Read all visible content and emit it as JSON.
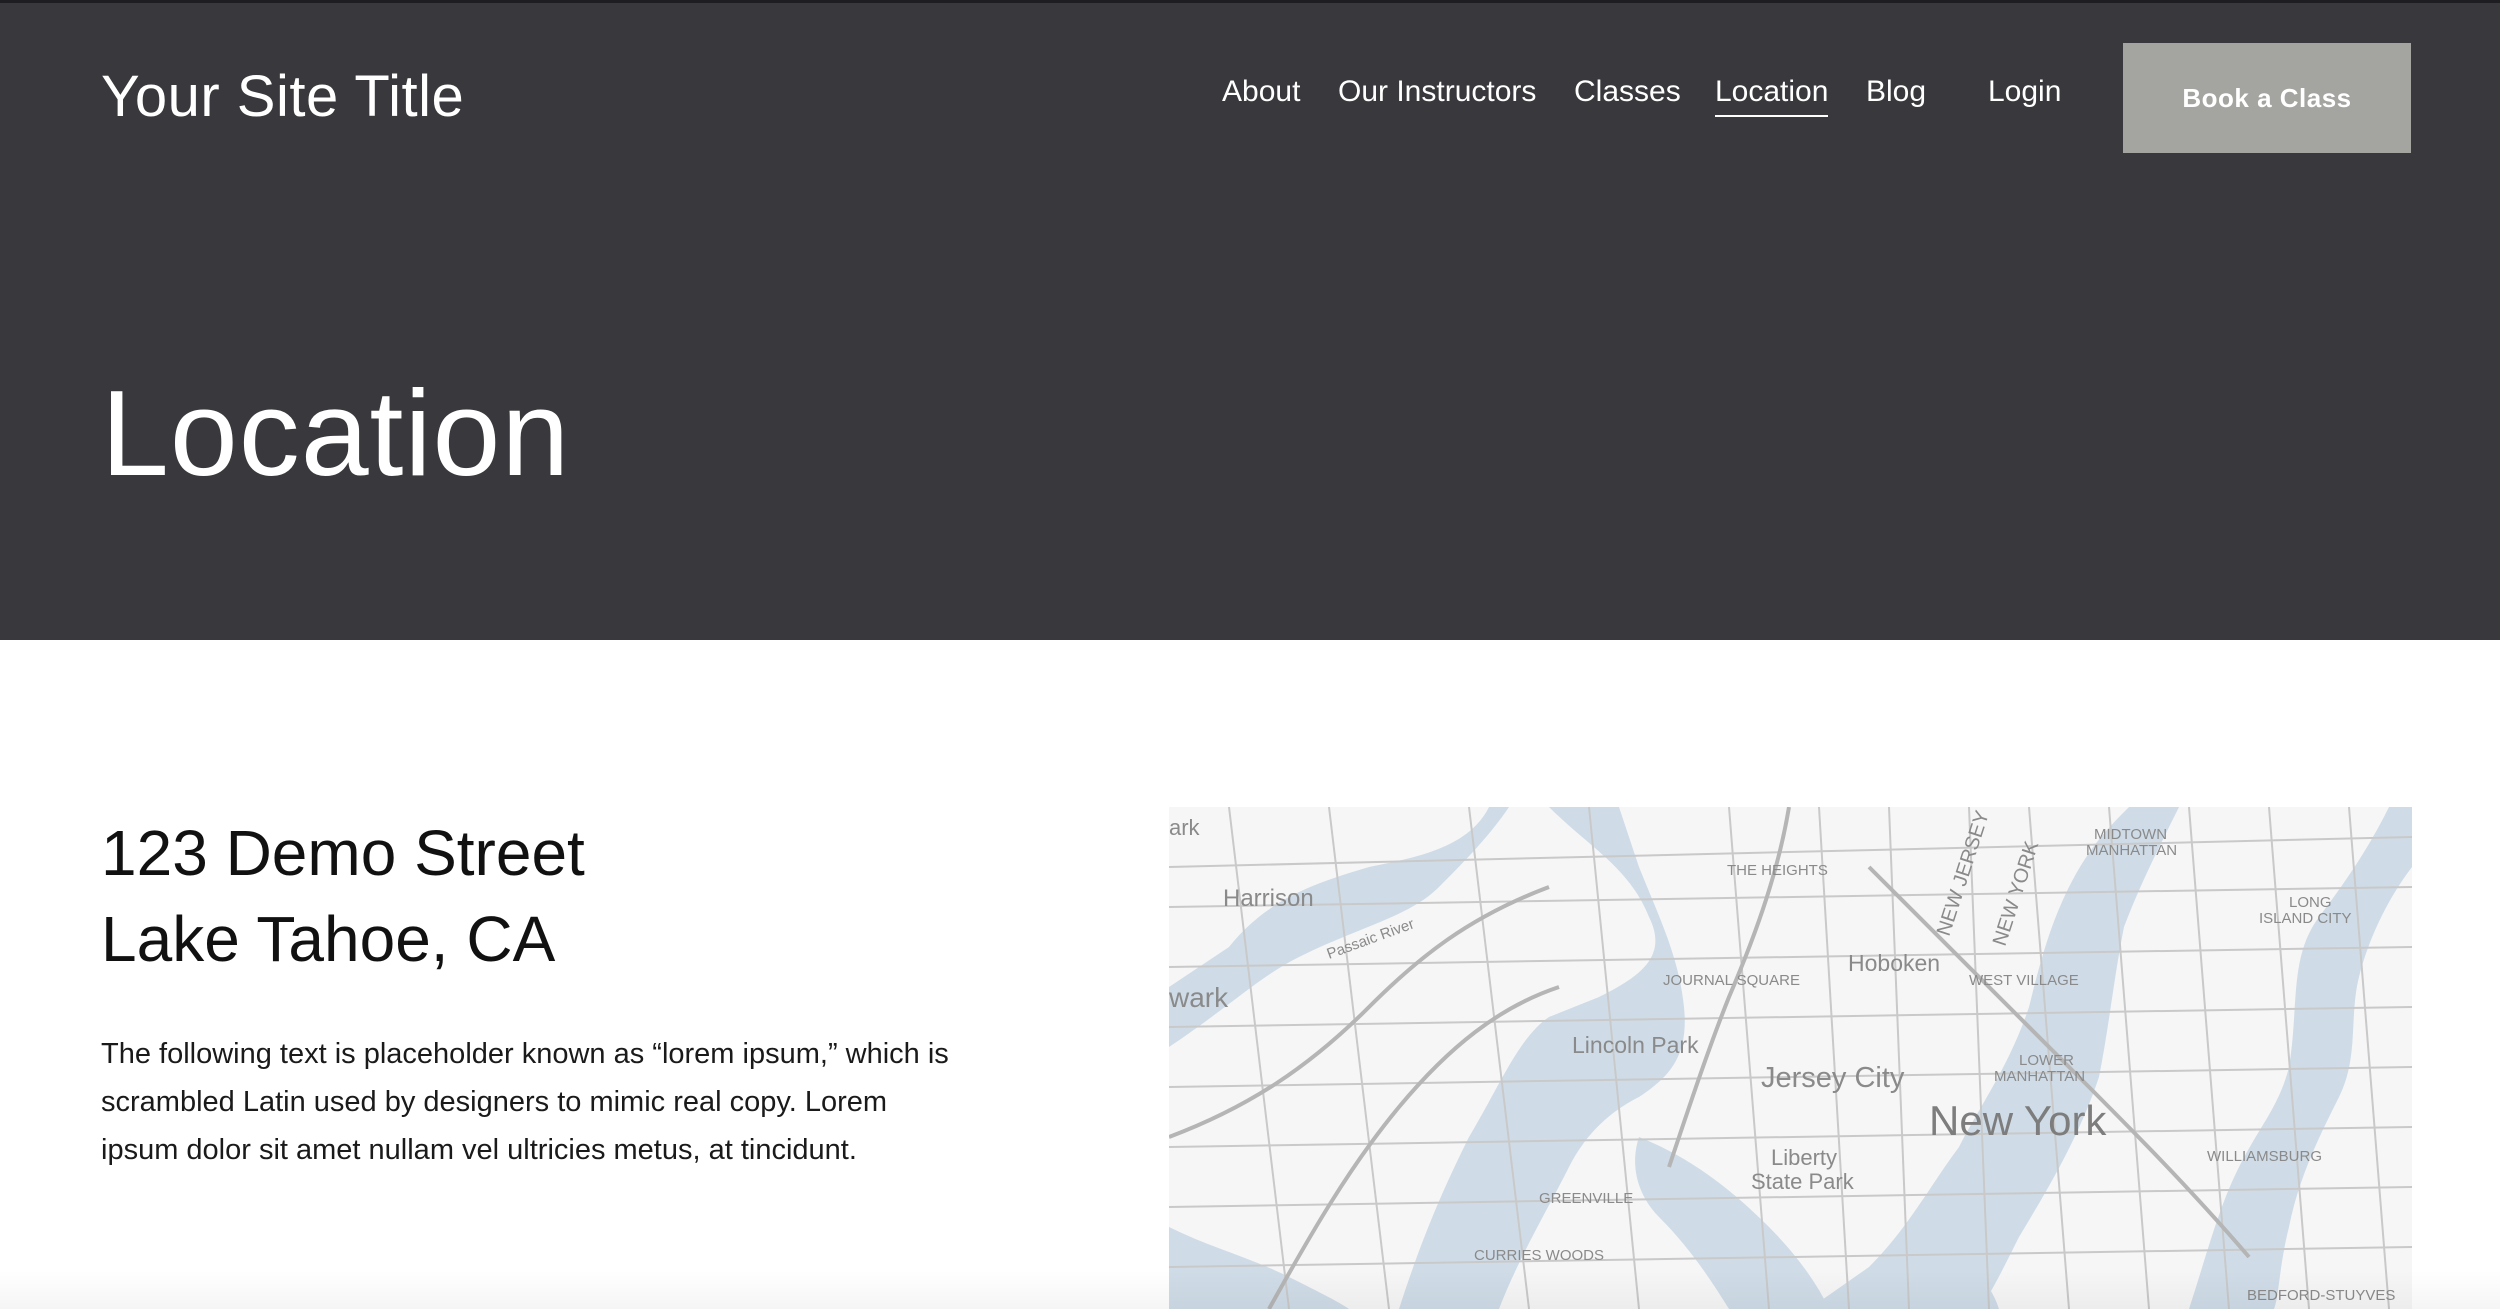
{
  "header": {
    "site_title": "Your Site Title",
    "nav": [
      {
        "label": "About"
      },
      {
        "label": "Our Instructors"
      },
      {
        "label": "Classes"
      },
      {
        "label": "Location",
        "active": true
      },
      {
        "label": "Blog"
      }
    ],
    "login_label": "Login",
    "cta_label": "Book a Class"
  },
  "hero": {
    "title": "Location"
  },
  "content": {
    "address_line1": "123 Demo Street",
    "address_line2": "Lake Tahoe, CA",
    "description": "The following text is placeholder known as “lorem ipsum,” which is scrambled Latin used by designers to mimic real copy. Lorem ipsum dolor sit amet nullam vel ultricies metus, at tincidunt."
  },
  "map": {
    "labels": {
      "ark": "ark",
      "harrison": "Harrison",
      "passaic_river": "Passaic River",
      "wark": "wark",
      "the_heights": "THE HEIGHTS",
      "journal_square": "JOURNAL SQUARE",
      "hoboken": "Hoboken",
      "lincoln_park": "Lincoln Park",
      "jersey_city": "Jersey City",
      "new_jersey": "NEW JERSEY",
      "new_york_vertical": "NEW YORK",
      "midtown": "MIDTOWN",
      "manhattan": "MANHATTAN",
      "west_village": "WEST VILLAGE",
      "lower": "LOWER",
      "manhattan_lower": "MANHATTAN",
      "new_york": "New York",
      "long": "LONG",
      "island_city": "ISLAND CITY",
      "liberty": "Liberty",
      "state_park": "State Park",
      "greenville": "GREENVILLE",
      "curries_woods": "CURRIES WOODS",
      "williamsburg": "WILLIAMSBURG",
      "bedford_stuyves": "BEDFORD-STUYVES"
    },
    "colors": {
      "water": "#cfdce7",
      "land": "#f6f6f6",
      "road": "#c9c9c9"
    }
  }
}
